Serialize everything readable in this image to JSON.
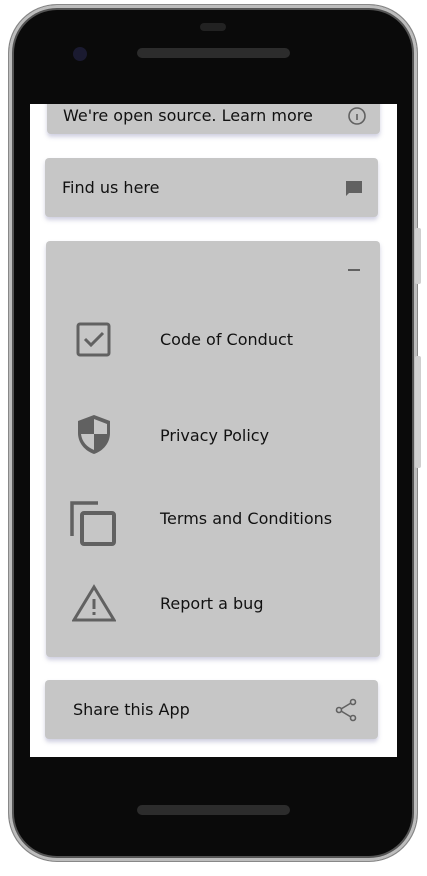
{
  "cards": {
    "open_source": {
      "label": "We're open source. Learn more",
      "icon": "info-icon"
    },
    "find_us": {
      "label": "Find us here",
      "icon": "chat-icon"
    },
    "links": {
      "collapse_icon": "minus-icon",
      "items": [
        {
          "label": "Code of Conduct",
          "icon": "checkbox-icon"
        },
        {
          "label": "Privacy Policy",
          "icon": "shield-icon"
        },
        {
          "label": "Terms and Conditions",
          "icon": "copy-icon"
        },
        {
          "label": "Report a bug",
          "icon": "warning-icon"
        }
      ]
    },
    "share": {
      "label": "Share this App",
      "icon": "share-icon"
    }
  },
  "colors": {
    "card": "#c6c6c6",
    "icon": "#616161"
  }
}
